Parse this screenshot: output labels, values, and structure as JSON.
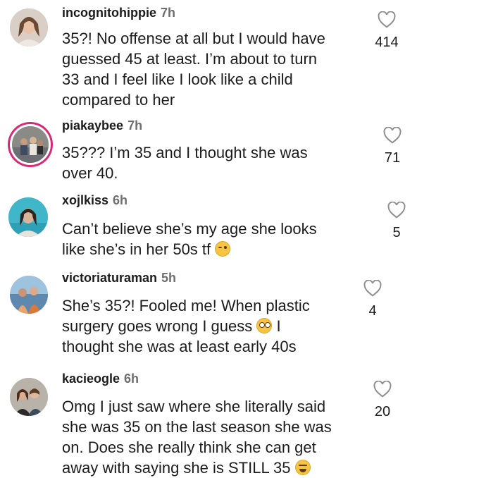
{
  "comments": [
    {
      "username": "incognitohippie",
      "time": "7h",
      "lines": [
        "35?! No offense at all but I would have",
        "guessed 45 at least. I’m about to turn",
        "33 and I feel like I look like a child",
        "compared to her"
      ],
      "likes": "414",
      "emoji": ""
    },
    {
      "username": "piakaybee",
      "time": "7h",
      "lines": [
        "35??? I’m 35 and I thought she was",
        "over 40."
      ],
      "likes": "71",
      "emoji": ""
    },
    {
      "username": "xojlkiss",
      "time": "6h",
      "lines": [
        "Can’t believe she’s my age she looks",
        "like she’s in her 50s tf"
      ],
      "likes": "5",
      "emoji": "winking-face-icon"
    },
    {
      "username": "victoriaturaman",
      "time": "5h",
      "lines": [
        "She’s 35?! Fooled me! When plastic",
        "surgery goes wrong I guess",
        "thought she was at least early 40s"
      ],
      "mid_suffix": "I",
      "likes": "4",
      "emoji": "flushed-face-icon"
    },
    {
      "username": "kacieogle",
      "time": "6h",
      "lines": [
        "Omg I just saw where she literally said",
        "she was 35 on the last season she was",
        "on. Does she really think she can get",
        "away with saying she is STILL 35"
      ],
      "likes": "20",
      "emoji": "grinning-squinting-face-icon"
    }
  ],
  "colors": {
    "text": "#1c1c1c",
    "muted": "#6e6e6e",
    "story_ring": "#d62976",
    "heart": "#8e8e8e"
  }
}
